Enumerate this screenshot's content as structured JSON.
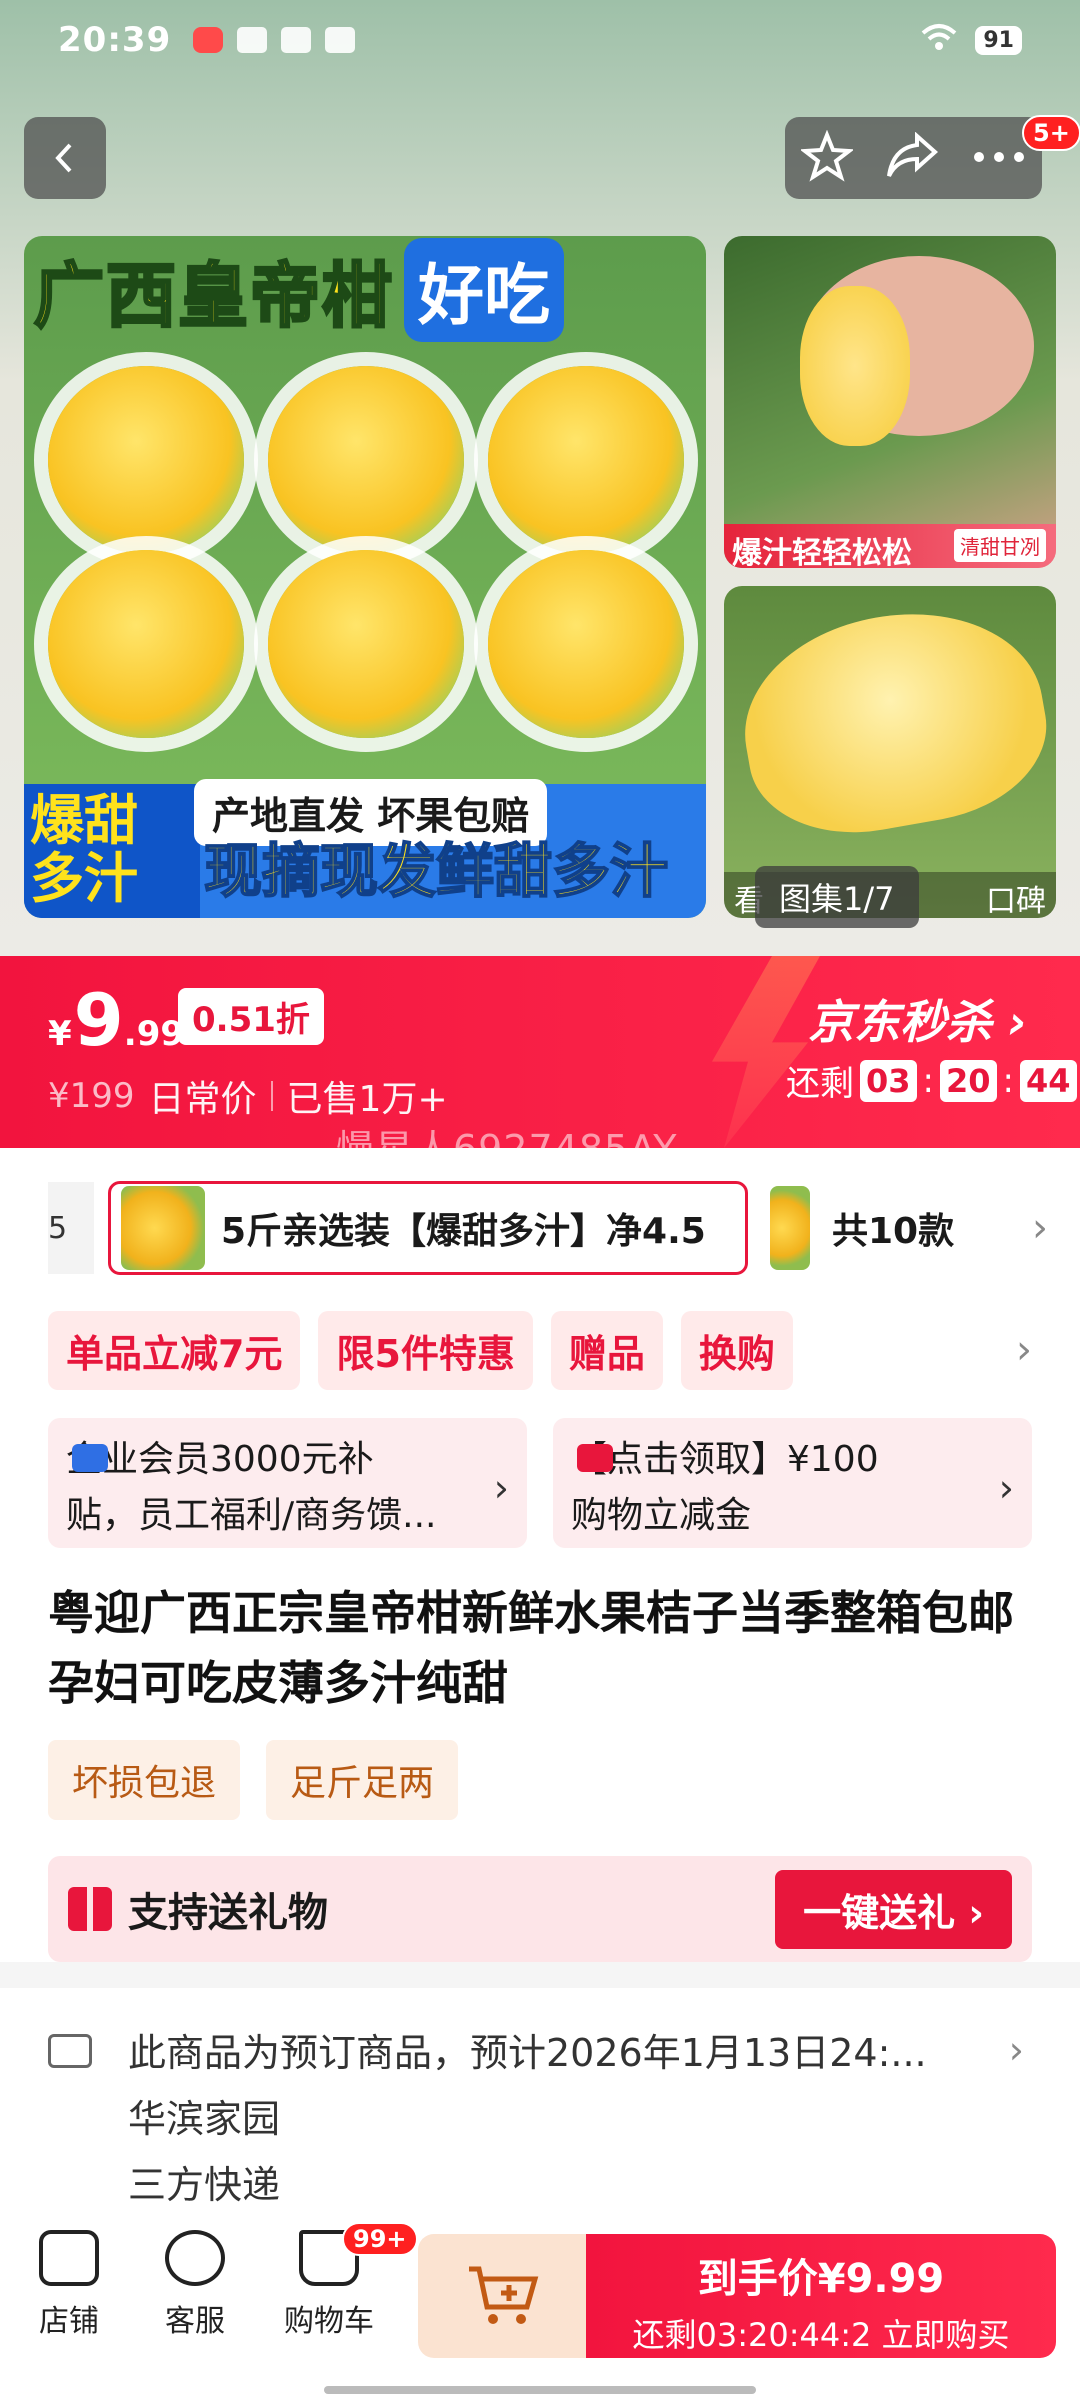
{
  "status_bar": {
    "time": "20:39",
    "battery": "91"
  },
  "gallery": {
    "main_title": "广西皇帝柑",
    "main_badge": "好吃",
    "side_left": "爆甜\n多汁",
    "tagline1": "产地直发 坏果包赔",
    "tagline2": "现摘现发鲜甜多汁",
    "side1_label": "爆汁轻轻松松",
    "side1_tag": "清甜甘冽",
    "counter": "图集1/7",
    "side2_left": "看",
    "side2_right": "口碑",
    "nav_badge": "5+"
  },
  "price": {
    "symbol": "¥",
    "integer": "9",
    "decimal": ".99",
    "discount": "0.51折",
    "original": "¥199",
    "original_label": "日常价",
    "sold": "已售1万+",
    "seckill": "京东秒杀",
    "remain_label": "还剩",
    "cd_h": "03",
    "cd_m": "20",
    "cd_s": "44"
  },
  "watermark": "慢星人6927485AY",
  "spec": {
    "prev_edge": "5",
    "selected": "5斤亲选装【爆甜多汁】净4.5",
    "count": "共10款"
  },
  "promos": [
    "单品立减7元",
    "限5件特惠",
    "赠品",
    "换购"
  ],
  "benefits": [
    {
      "line1": "企业会员3000元补",
      "line2": "贴，员工福利/商务馈...",
      "color": "#2f6fe4"
    },
    {
      "line1": "【点击领取】¥100",
      "line2": "购物立减金",
      "color": "#e8163c"
    }
  ],
  "title": "粤迎广西正宗皇帝柑新鲜水果桔子当季整箱包邮孕妇可吃皮薄多汁纯甜",
  "tags": [
    "坏损包退",
    "足斤足两"
  ],
  "gift": {
    "text": "支持送礼物",
    "button": "一键送礼 ›"
  },
  "delivery": {
    "line1": "此商品为预订商品，预计2026年1月13日24:...",
    "line2": "华滨家园",
    "line3": "三方快递"
  },
  "bottom": {
    "shop": "店铺",
    "service": "客服",
    "cart": "购物车",
    "cart_badge": "99+",
    "buy_line1": "到手价¥9.99",
    "buy_line2": "还剩03:20:44:2  立即购买"
  },
  "colors": {
    "accent": "#e8163c",
    "tag_text": "#b85a14"
  }
}
